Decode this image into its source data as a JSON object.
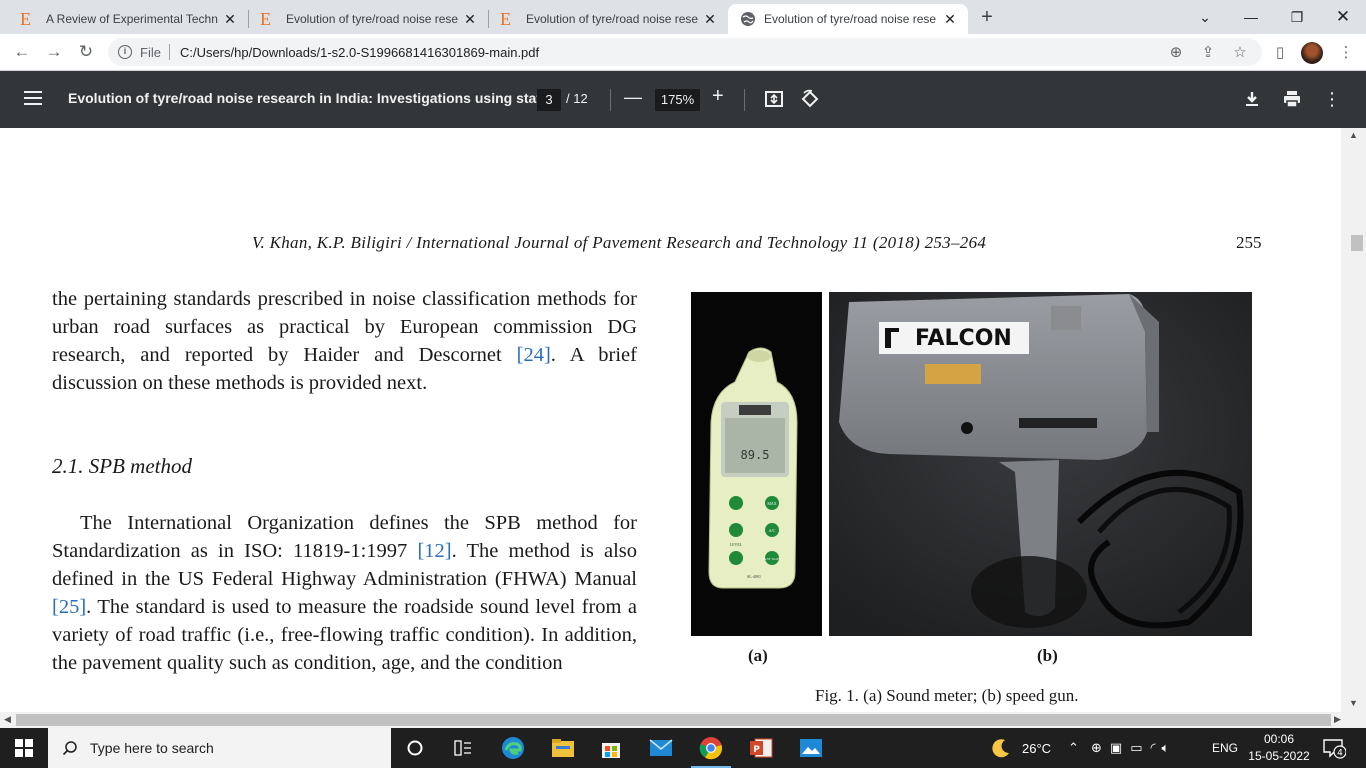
{
  "tabs": [
    {
      "title": "A Review of Experimental Technic",
      "favicon": "E"
    },
    {
      "title": "Evolution of tyre/road noise rese",
      "favicon": "E"
    },
    {
      "title": "Evolution of tyre/road noise rese",
      "favicon": "E"
    },
    {
      "title": "Evolution of tyre/road noise rese",
      "favicon": "globe"
    }
  ],
  "address": {
    "scheme_label": "File",
    "url": "C:/Users/hp/Downloads/1-s2.0-S1996681416301869-main.pdf"
  },
  "pdf_toolbar": {
    "title": "Evolution of tyre/road noise research in India: Investigations using stat...",
    "current_page": "3",
    "total_pages": "/ 12",
    "zoom": "175%"
  },
  "page": {
    "running_head": "V. Khan, K.P. Biligiri / International Journal of Pavement Research and Technology 11 (2018) 253–264",
    "page_number": "255",
    "para1": {
      "before_ref": "the pertaining standards prescribed in noise classification methods for urban road surfaces as practical by European commission DG research, and reported by Haider and Descornet ",
      "ref": "[24]",
      "after_ref": ". A brief discussion on these methods is provided next."
    },
    "section_heading": "2.1. SPB method",
    "para2": {
      "t1": "The International Organization defines the SPB method for Standardization as in ISO: 11819-1:1997 ",
      "ref1": "[12]",
      "t2": ". The method is also defined in the US Federal Highway Administration (FHWA) Manual ",
      "ref2": "[25]",
      "t3": ". The standard is used to measure the roadside sound level from a variety of road traffic (i.e., free-flowing traffic condition). In addition, the pavement quality such as condition, age, and the condition"
    },
    "figure": {
      "label_a": "(a)",
      "label_b": "(b)",
      "caption": "Fig. 1. (a) Sound meter; (b) speed gun.",
      "meter_reading": "89.5",
      "gun_brand": "FALCON",
      "meter_buttons": [
        "MAX",
        "A/C",
        "FAST SLOW"
      ],
      "meter_level": "LEVEL",
      "meter_model": "SL-4001"
    }
  },
  "taskbar": {
    "search_placeholder": "Type here to search",
    "weather": "26°C",
    "language": "ENG",
    "time": "00:06",
    "date": "15-05-2022",
    "notifications": "4"
  },
  "colors": {
    "accent_link": "#2a6ebb",
    "pdf_toolbar": "#323639",
    "favicon_orange": "#e8711a"
  }
}
